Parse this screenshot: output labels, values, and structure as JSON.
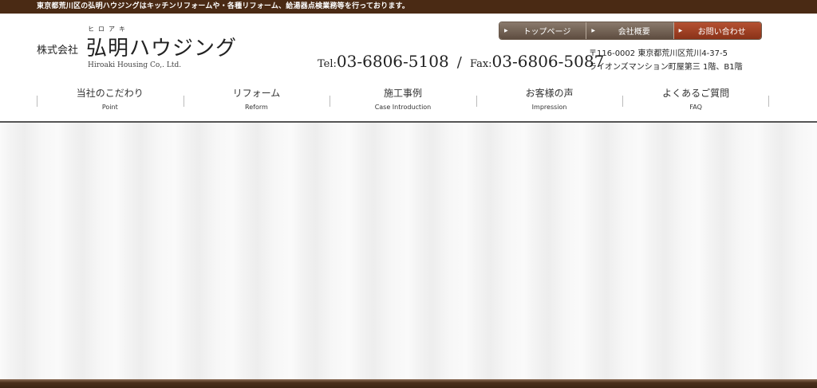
{
  "topbar": {
    "text": "東京都荒川区の弘明ハウジングはキッチンリフォームや・各種リフォーム、給湯器点検業務等を行っております。"
  },
  "logo": {
    "prefix": "株式会社",
    "ruby": "ヒロアキ",
    "name": "弘明ハウジング",
    "english": "Hiroaki Housing Co,. Ltd."
  },
  "contact": {
    "tel_label": "Tel:",
    "tel": "03-6806-5108",
    "separator": "/",
    "fax_label": "Fax:",
    "fax": "03-6806-5087"
  },
  "address": {
    "line1": "〒116-0002 東京都荒川区荒川4-37-5",
    "line2": "ライオンズマンション町屋第三 1階、B1階"
  },
  "util_nav": [
    {
      "label": "トップページ"
    },
    {
      "label": "会社概要"
    },
    {
      "label": "お問い合わせ"
    }
  ],
  "colors": {
    "topbar": "#4a2a14",
    "util_button": "#6e5d50",
    "util_button_accent": "#9c4024",
    "footer": "#3c2414"
  },
  "gnav": [
    {
      "jp": "当社のこだわり",
      "en": "Point"
    },
    {
      "jp": "リフォーム",
      "en": "Reform"
    },
    {
      "jp": "施工事例",
      "en": "Case Introduction"
    },
    {
      "jp": "お客様の声",
      "en": "Impression"
    },
    {
      "jp": "よくあるご質問",
      "en": "FAQ"
    }
  ]
}
